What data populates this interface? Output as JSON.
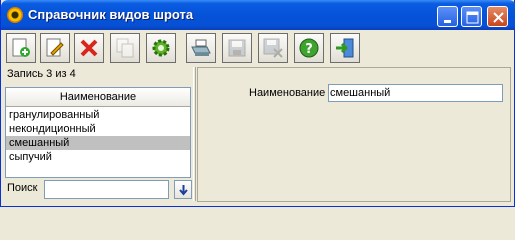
{
  "window": {
    "title": "Справочник видов шрота",
    "controls": {
      "minimize": "minimize",
      "maximize": "maximize",
      "close": "close"
    }
  },
  "toolbar": {
    "buttons": [
      {
        "name": "add",
        "icon": "add-icon",
        "enabled": true
      },
      {
        "name": "edit",
        "icon": "edit-icon",
        "enabled": true
      },
      {
        "name": "delete",
        "icon": "delete-icon",
        "enabled": true
      },
      {
        "name": "copy",
        "icon": "copy-icon",
        "enabled": false
      },
      {
        "name": "settings",
        "icon": "gear-icon",
        "enabled": true
      },
      {
        "name": "print",
        "icon": "print-icon",
        "enabled": true
      },
      {
        "name": "save",
        "icon": "save-icon",
        "enabled": false
      },
      {
        "name": "save-close",
        "icon": "save-close-icon",
        "enabled": false
      },
      {
        "name": "help",
        "icon": "help-icon",
        "enabled": true
      },
      {
        "name": "exit",
        "icon": "exit-icon",
        "enabled": true
      }
    ]
  },
  "record_status": "Запись 3 из 4",
  "list": {
    "header": "Наименование",
    "items": [
      "гранулированный",
      "некондиционный",
      "смешанный",
      "сыпучий"
    ],
    "selected_index": 2
  },
  "search": {
    "label": "Поиск",
    "value": ""
  },
  "detail": {
    "name_label": "Наименование",
    "name_value": "смешанный"
  },
  "colors": {
    "titlebar": "#0553d8",
    "selection": "#c0c0c0",
    "window_bg": "#ece9d8"
  }
}
